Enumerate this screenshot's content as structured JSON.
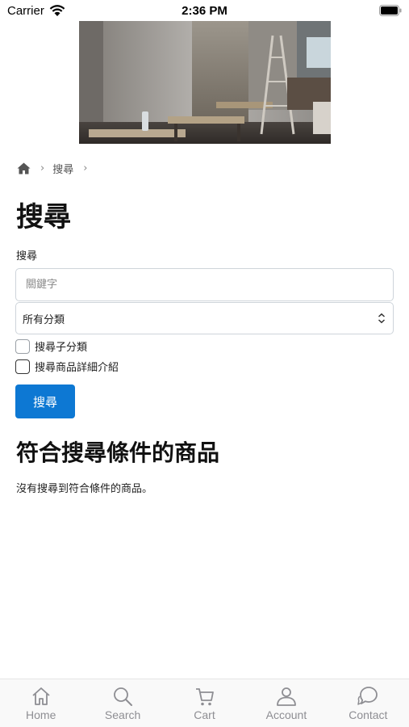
{
  "status_bar": {
    "carrier": "Carrier",
    "time": "2:36 PM",
    "wifi_icon": "wifi-icon",
    "battery_icon": "battery-icon"
  },
  "hero": {
    "icon": "store-interior-photo"
  },
  "breadcrumb": {
    "home_icon": "home-icon",
    "items": [
      "搜尋"
    ]
  },
  "page": {
    "title": "搜尋",
    "search_label": "搜尋",
    "search_input": {
      "value": "",
      "placeholder": "關鍵字"
    },
    "category_select": {
      "selected": "所有分類"
    },
    "checkboxes": [
      {
        "label": "搜尋子分類",
        "checked": false
      },
      {
        "label": "搜尋商品詳細介紹",
        "checked": false
      }
    ],
    "search_button_label": "搜尋",
    "results_title": "符合搜尋條件的商品",
    "no_results_text": "沒有搜尋到符合條件的商品。"
  },
  "tab_bar": {
    "tabs": [
      {
        "label": "Home",
        "icon": "home-icon"
      },
      {
        "label": "Search",
        "icon": "search-icon"
      },
      {
        "label": "Cart",
        "icon": "cart-icon"
      },
      {
        "label": "Account",
        "icon": "person-icon"
      },
      {
        "label": "Contact",
        "icon": "chat-icon"
      }
    ]
  },
  "colors": {
    "primary": "#0d78d3",
    "tab_inactive": "#8e8e93"
  }
}
